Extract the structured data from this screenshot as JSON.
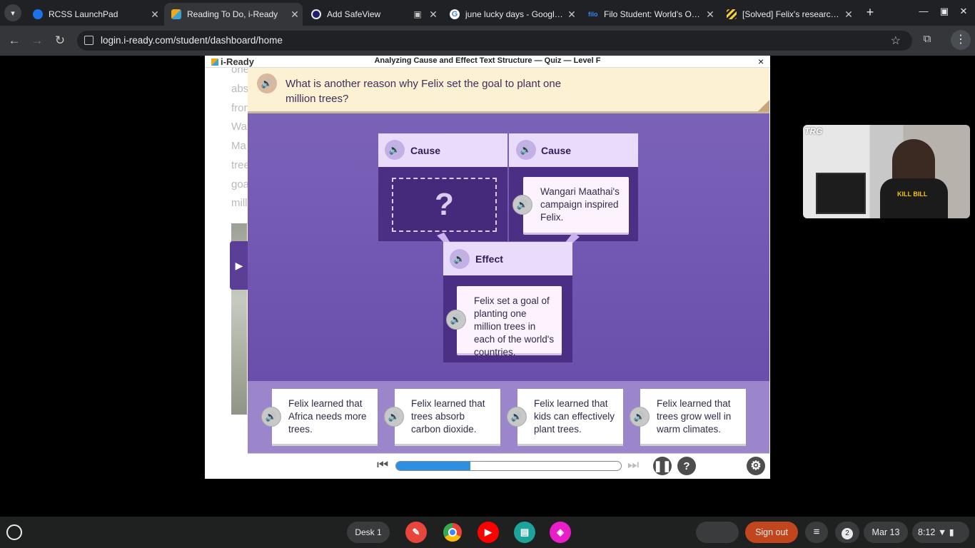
{
  "browser": {
    "tabs": [
      {
        "title": "RCSS LaunchPad",
        "favicon_color": "#1a73e8"
      },
      {
        "title": "Reading To Do, i-Ready",
        "favicon_color": "#f0a81d"
      },
      {
        "title": "Add SafeView",
        "favicon_color": "#e8eaed"
      },
      {
        "title": "june lucky days - Google Se",
        "favicon_color": "#ea4335"
      },
      {
        "title": "Filo Student: World's Only L",
        "favicon_color": "#3b82f6"
      },
      {
        "title": "[Solved] Felix's research fo",
        "favicon_color": "#f4d03f"
      }
    ],
    "url": "login.i-ready.com/student/dashboard/home",
    "new_tab_glyph": "+"
  },
  "page_background": {
    "text_lines": [
      "one",
      "abs",
      "fron",
      "Wa",
      "Ma",
      "tree",
      "goa",
      "mill"
    ]
  },
  "iready": {
    "logo": "i-Ready",
    "title": "Analyzing Cause and Effect Text Structure — Quiz — Level F",
    "close": "×",
    "question": "What is another reason why Felix set the goal to plant one million trees?",
    "cause1_label": "Cause",
    "cause1_slot": "?",
    "cause2_label": "Cause",
    "cause2_text": "Wangari Maathai's campaign inspired Felix.",
    "effect_label": "Effect",
    "effect_text": "Felix set a goal of planting one million trees in each of the world's countries.",
    "answers": [
      "Felix learned that Africa needs more trees.",
      "Felix learned that trees absorb carbon dioxide.",
      "Felix learned that kids can effectively plant trees.",
      "Felix learned that trees grow well in warm climates."
    ],
    "progress_fraction": 0.33,
    "colors": {
      "accent": "#6a4fab",
      "progress": "#2c8fe0",
      "banner": "#fdf1d3"
    }
  },
  "webcam": {
    "badge": "TRG",
    "shirt_text": "KILL BILL"
  },
  "shelf": {
    "desk_label": "Desk 1",
    "sign_out": "Sign out",
    "notification_count": "2",
    "date": "Mar 13",
    "time": "8:12"
  }
}
